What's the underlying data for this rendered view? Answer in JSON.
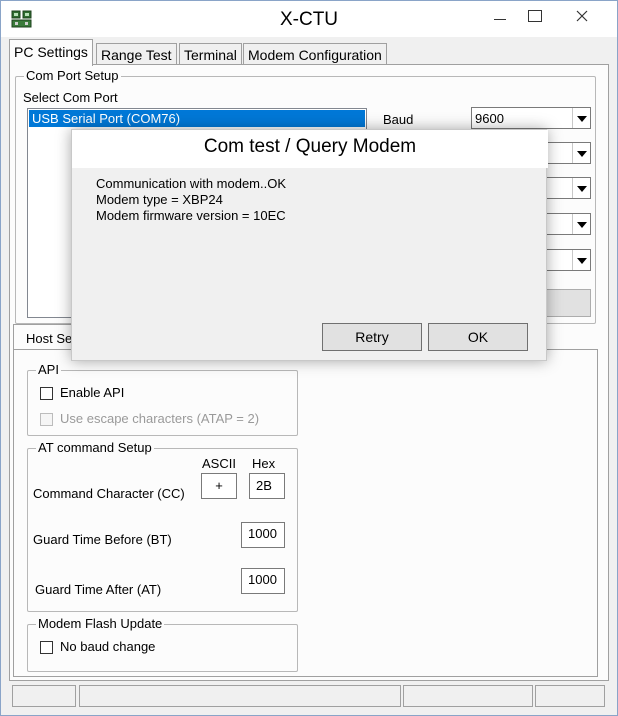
{
  "window": {
    "title": "X-CTU"
  },
  "tabs": [
    {
      "label": "PC Settings"
    },
    {
      "label": "Range Test"
    },
    {
      "label": "Terminal"
    },
    {
      "label": "Modem Configuration"
    }
  ],
  "com_port_setup": {
    "group_title": "Com Port Setup",
    "select_label": "Select Com Port",
    "ports": [
      {
        "label": "USB Serial Port (COM76)",
        "selected": true
      }
    ],
    "baud_label": "Baud",
    "baud_value": "9600"
  },
  "host_setup": {
    "tab_label_partial": "Host Se"
  },
  "api": {
    "group_title": "API",
    "enable_api_label": "Enable API",
    "escape_label": "Use escape characters (ATAP = 2)"
  },
  "at_command": {
    "group_title": "AT command Setup",
    "ascii_header": "ASCII",
    "hex_header": "Hex",
    "command_char_label": "Command Character (CC)",
    "command_char_ascii": "+",
    "command_char_hex": "2B",
    "guard_before_label": "Guard Time Before (BT)",
    "guard_before_value": "1000",
    "guard_after_label": "Guard Time After (AT)",
    "guard_after_value": "1000"
  },
  "flash_update": {
    "group_title": "Modem Flash Update",
    "no_baud_change_label": "No baud change"
  },
  "dialog": {
    "title": "Com test / Query Modem",
    "messages": [
      "Communication with modem..OK",
      "Modem type = XBP24",
      "Modem firmware version = 10EC"
    ],
    "retry_label": "Retry",
    "ok_label": "OK"
  },
  "colors": {
    "selection": "#0078d7",
    "window_bg": "#f0f0f0"
  }
}
